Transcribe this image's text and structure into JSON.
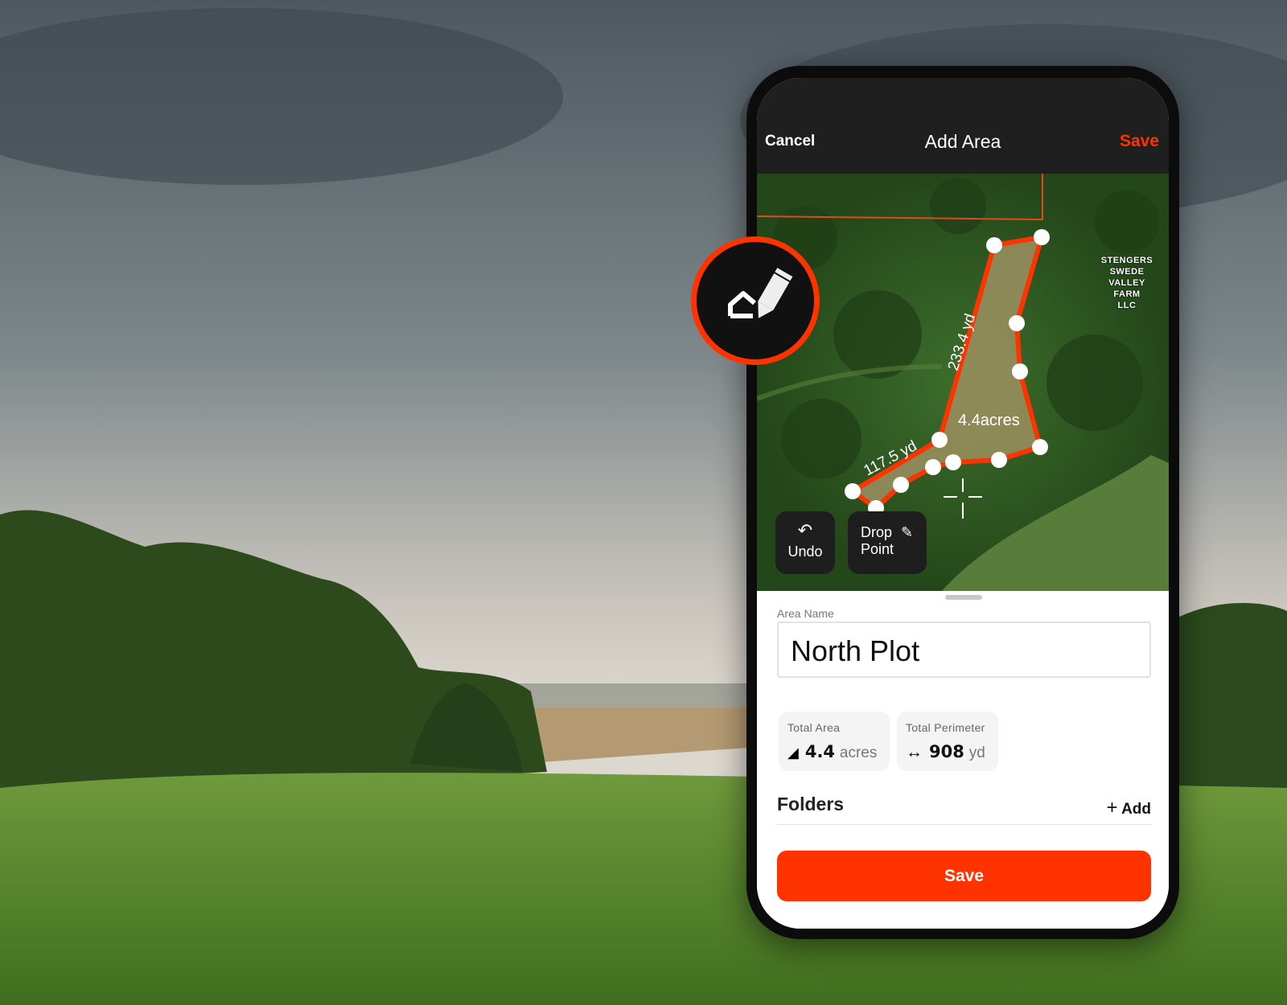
{
  "header": {
    "cancel_label": "Cancel",
    "title": "Add Area",
    "save_label": "Save"
  },
  "map": {
    "parcel_label": [
      "STENGERS",
      "SWEDE",
      "VALLEY",
      "FARM",
      "LLC"
    ],
    "area_label": "4.4acres",
    "segment_labels": [
      "233.4 yd",
      "117.5 yd"
    ],
    "undo_label": "Undo",
    "drop_point_label": [
      "Drop",
      "Point"
    ],
    "polygon_color": "#ff3300"
  },
  "form": {
    "area_name_label": "Area Name",
    "area_name_value": "North Plot",
    "total_area": {
      "title": "Total Area",
      "value": "4.4",
      "unit": "acres",
      "icon": "polygon-area-icon"
    },
    "total_perimeter": {
      "title": "Total Perimeter",
      "value": "908",
      "unit": "yd",
      "icon": "double-arrow-icon"
    },
    "folders_label": "Folders",
    "add_label": "Add",
    "save_label": "Save"
  },
  "colors": {
    "accent": "#ff3300",
    "header_bg": "#1f1f1f"
  }
}
